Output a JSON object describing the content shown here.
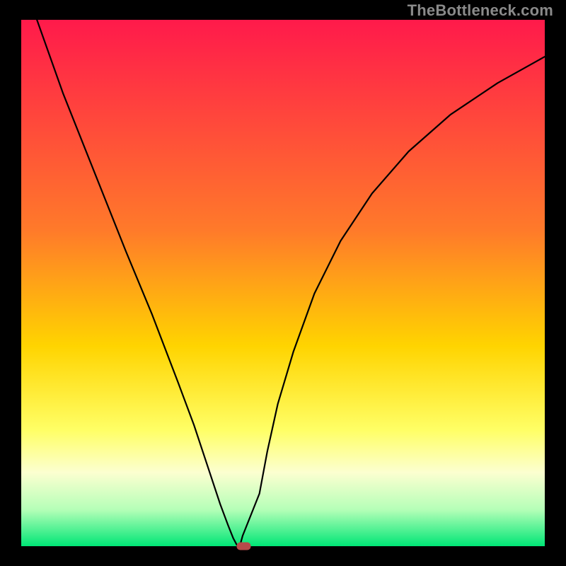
{
  "watermark": "TheBottleneck.com",
  "chart_data": {
    "type": "line",
    "title": "",
    "xlabel": "",
    "ylabel": "",
    "xlim": [
      0,
      100
    ],
    "ylim": [
      0,
      100
    ],
    "gradient_stops": [
      {
        "offset": 0,
        "color": "#ff1a4b"
      },
      {
        "offset": 40,
        "color": "#ff7a2a"
      },
      {
        "offset": 62,
        "color": "#ffd400"
      },
      {
        "offset": 78,
        "color": "#ffff66"
      },
      {
        "offset": 86,
        "color": "#fcffd0"
      },
      {
        "offset": 93,
        "color": "#b6ffb8"
      },
      {
        "offset": 100,
        "color": "#00e676"
      }
    ],
    "curve": {
      "x": [
        3,
        8,
        14,
        20,
        25,
        30,
        33,
        36,
        38,
        39.5,
        40.5,
        41.2,
        41.8,
        42.3,
        45.5,
        47,
        49,
        52,
        56,
        61,
        67,
        74,
        82,
        91,
        100
      ],
      "y": [
        100,
        86,
        71,
        56,
        44,
        31,
        23,
        14,
        8,
        4,
        1.5,
        0.2,
        0.2,
        2,
        10,
        18,
        27,
        37,
        48,
        58,
        67,
        75,
        82,
        88,
        93
      ]
    },
    "curve_min_x": 41.5,
    "marker": {
      "x": 42.5,
      "y": 0.0,
      "color": "#b84a4a"
    }
  }
}
